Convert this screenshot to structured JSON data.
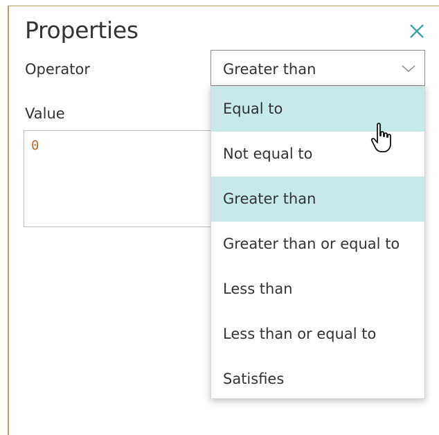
{
  "panel": {
    "title": "Properties",
    "close_icon": "close-icon",
    "accent_color": "#3aa6a4"
  },
  "operator": {
    "label": "Operator",
    "selected": "Greater than",
    "chevron_icon": "chevron-down-icon"
  },
  "value": {
    "label": "Value",
    "text": "0"
  },
  "dropdown": {
    "highlight_color": "#c8e9ea",
    "items": [
      {
        "label": "Equal to",
        "hovered": true
      },
      {
        "label": "Not equal to",
        "hovered": false
      },
      {
        "label": "Greater than",
        "selected": true
      },
      {
        "label": "Greater than or equal to",
        "hovered": false
      },
      {
        "label": "Less than",
        "hovered": false
      },
      {
        "label": "Less than or equal to",
        "hovered": false
      },
      {
        "label": "Satisfies",
        "hovered": false
      }
    ]
  },
  "cursor_icon": "hand-pointer-icon"
}
